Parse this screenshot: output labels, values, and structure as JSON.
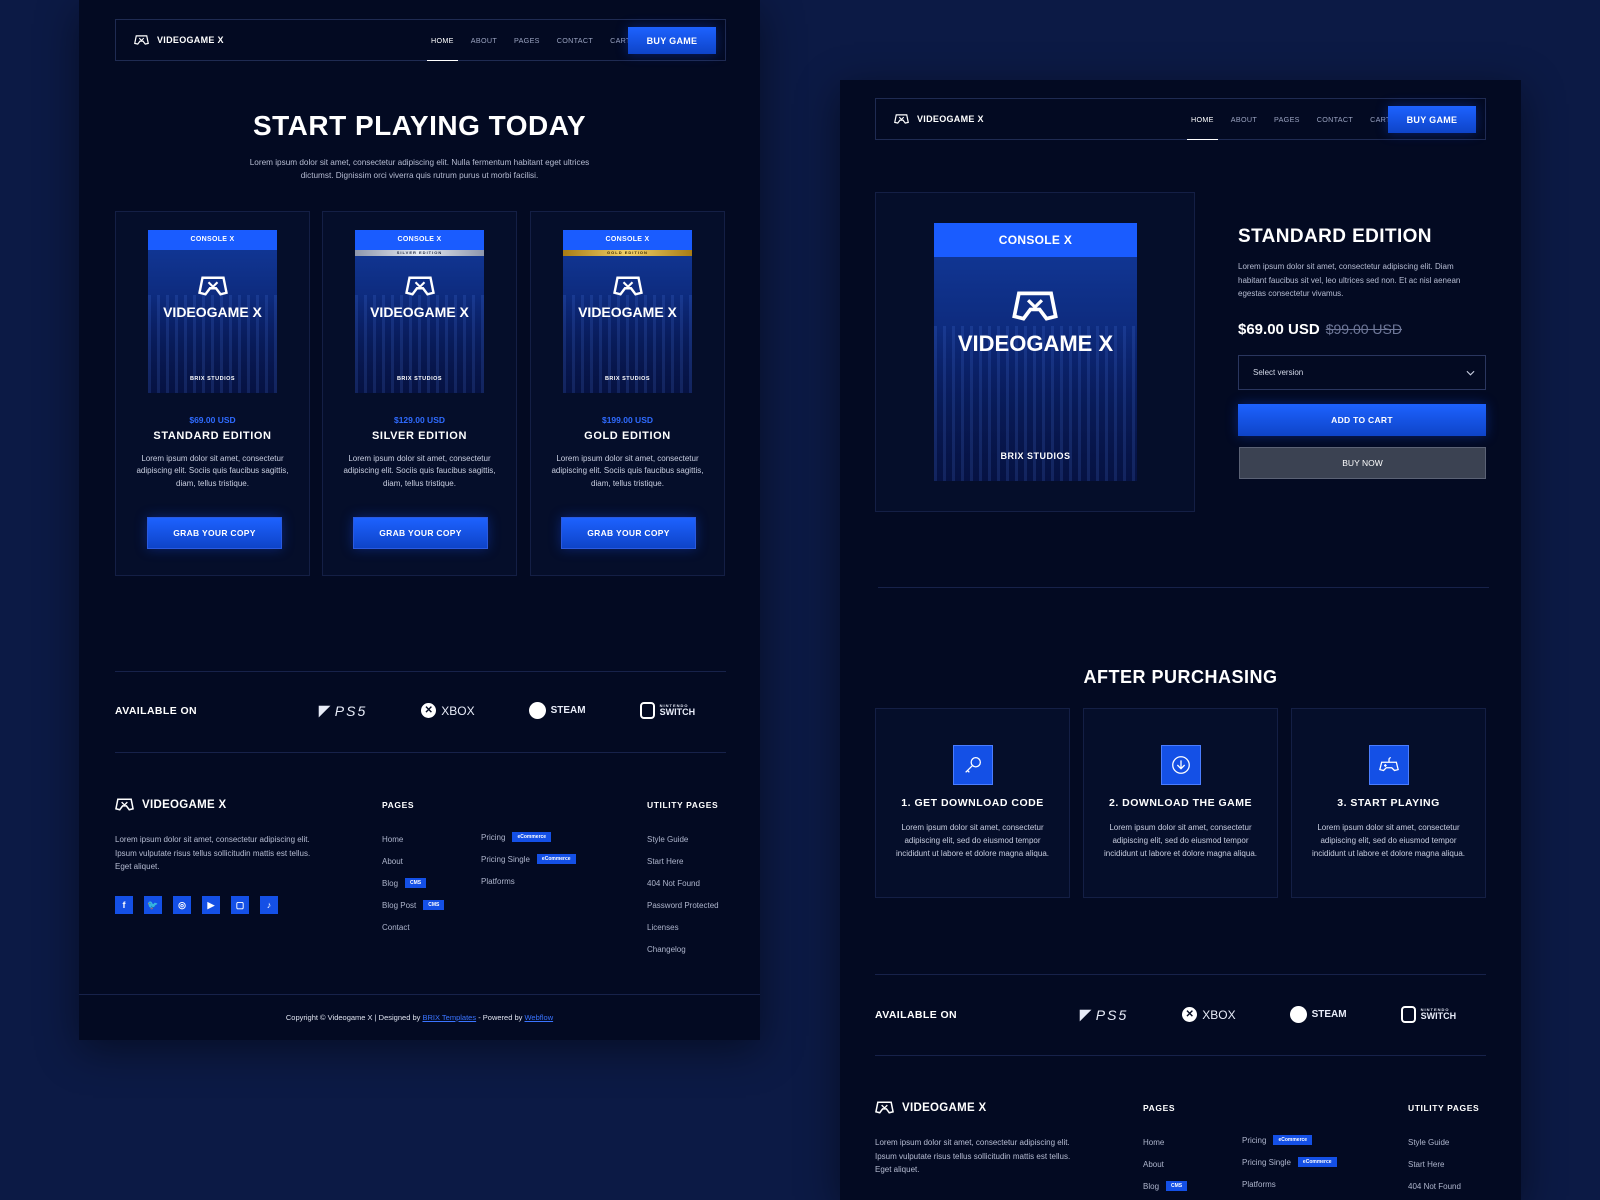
{
  "brand": {
    "name": "VIDEOGAME X"
  },
  "nav": {
    "links": [
      "HOME",
      "ABOUT",
      "PAGES",
      "CONTACT",
      "CART (3)"
    ],
    "cta": "BUY GAME"
  },
  "pricing_page": {
    "title": "START PLAYING TODAY",
    "intro": "Lorem ipsum dolor sit amet, consectetur adipiscing elit. Nulla fermentum habitant eget ultrices dictumst. Dignissim orci viverra quis rutrum purus ut morbi facilisi.",
    "box_top": "CONSOLE X",
    "box_studio": "BRIX STUDIOS",
    "products": [
      {
        "price": "$69.00 USD",
        "edition": "STANDARD EDITION",
        "ribbon": "",
        "desc": "Lorem ipsum dolor sit amet, consectetur adipiscing elit. Sociis quis faucibus sagittis, diam, tellus tristique.",
        "cta": "GRAB YOUR COPY"
      },
      {
        "price": "$129.00 USD",
        "edition": "SILVER EDITION",
        "ribbon": "SILVER EDITION",
        "desc": "Lorem ipsum dolor sit amet, consectetur adipiscing elit. Sociis quis faucibus sagittis, diam, tellus tristique.",
        "cta": "GRAB YOUR COPY"
      },
      {
        "price": "$199.00 USD",
        "edition": "GOLD EDITION",
        "ribbon": "GOLD EDITION",
        "desc": "Lorem ipsum dolor sit amet, consectetur adipiscing elit. Sociis quis faucibus sagittis, diam, tellus tristique.",
        "cta": "GRAB YOUR COPY"
      }
    ]
  },
  "available": {
    "label": "AVAILABLE ON",
    "platforms": [
      "PS5",
      "XBOX",
      "STEAM",
      "SWITCH"
    ],
    "switch_small": "NINTENDO"
  },
  "footer": {
    "about": "Lorem ipsum dolor sit amet, consectetur adipiscing elit. Ipsum vulputate risus tellus sollicitudin mattis est tellus. Eget aliquet.",
    "pages_heading": "PAGES",
    "pages_col1": [
      "Home",
      "About",
      "Blog",
      "Blog Post",
      "Contact"
    ],
    "pages_col2": [
      "Pricing",
      "Pricing Single",
      "Platforms"
    ],
    "tag_cms": "CMS",
    "tag_ecommerce": "eCommerce",
    "utility_heading": "UTILITY PAGES",
    "utility": [
      "Style Guide",
      "Start Here",
      "404 Not Found",
      "Password Protected",
      "Licenses",
      "Changelog"
    ],
    "copyright_pre": "Copyright © Videogame X | Designed by",
    "designer": "BRIX Templates",
    "powered_pre": "- Powered by",
    "powered": "Webflow"
  },
  "product_page": {
    "box_top": "CONSOLE X",
    "box_name": "VIDEOGAME X",
    "box_studio": "BRIX STUDIOS",
    "title": "STANDARD EDITION",
    "desc": "Lorem ipsum dolor sit amet, consectetur adipiscing elit. Diam habitant faucibus sit vel, leo ultrices sed non. Et ac nisl aenean egestas consectetur vivamus.",
    "price": "$69.00 USD",
    "old_price": "$99.00 USD",
    "select_placeholder": "Select version",
    "add_to_cart": "ADD TO CART",
    "buy_now": "BUY NOW",
    "after_title": "AFTER PURCHASING",
    "steps": [
      {
        "title": "1. GET DOWNLOAD CODE",
        "icon": "key-icon",
        "desc": "Lorem ipsum dolor sit amet, consectetur adipiscing elit, sed do eiusmod tempor incididunt ut labore et dolore magna aliqua."
      },
      {
        "title": "2. DOWNLOAD THE GAME",
        "icon": "download-icon",
        "desc": "Lorem ipsum dolor sit amet, consectetur adipiscing elit, sed do eiusmod tempor incididunt ut labore et dolore magna aliqua."
      },
      {
        "title": "3. START PLAYING",
        "icon": "gamepad-icon",
        "desc": "Lorem ipsum dolor sit amet, consectetur adipiscing elit, sed do eiusmod tempor incididunt ut labore et dolore magna aliqua."
      }
    ]
  },
  "colors": {
    "accent": "#1450e6",
    "background": "#030a22",
    "page": "#0c1a45",
    "price": "#2f6bff"
  }
}
